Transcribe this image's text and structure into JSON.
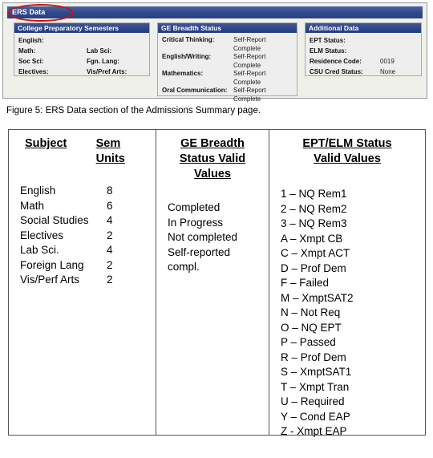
{
  "screenshot": {
    "window_title": "ERS Data",
    "annotation": "red-oval-around-ers-data",
    "accent_titlebar_color": "#2f4a8c",
    "annotation_color": "#cc1111",
    "panels": [
      {
        "id": "college_prep",
        "title": "College Preparatory Semesters",
        "fields": [
          {
            "label": "English:",
            "value": ""
          },
          {
            "label": "",
            "value": ""
          },
          {
            "label": "Math:",
            "value": ""
          },
          {
            "label": "Lab Sci:",
            "value": ""
          },
          {
            "label": "Soc Sci:",
            "value": ""
          },
          {
            "label": "Fgn. Lang:",
            "value": ""
          },
          {
            "label": "Electives:",
            "value": ""
          },
          {
            "label": "Vis/Pref Arts:",
            "value": ""
          }
        ]
      },
      {
        "id": "ge_breadth",
        "title": "GE Breadth Status",
        "fields": [
          {
            "label": "Critical Thinking:",
            "value": "Self-Report"
          },
          {
            "label": "",
            "value": "Complete"
          },
          {
            "label": "English/Writing:",
            "value": "Self-Report"
          },
          {
            "label": "",
            "value": "Complete"
          },
          {
            "label": "Mathematics:",
            "value": "Self-Report"
          },
          {
            "label": "",
            "value": "Complete"
          },
          {
            "label": "Oral Communication:",
            "value": "Self-Report"
          },
          {
            "label": "",
            "value": "Complete"
          }
        ]
      },
      {
        "id": "additional_data",
        "title": "Additional Data",
        "fields": [
          {
            "label": "EPT Status:",
            "value": ""
          },
          {
            "label": "ELM Status:",
            "value": ""
          },
          {
            "label": "Residence Code:",
            "value": "0019"
          },
          {
            "label": "CSU Cred Status:",
            "value": "None"
          }
        ]
      }
    ]
  },
  "caption": "Figure 5:  ERS Data section of the Admissions Summary page.",
  "table": {
    "subject_column": {
      "header_subject": "Subject",
      "header_units": "Sem Units",
      "rows": [
        {
          "subject": "English",
          "units": "8"
        },
        {
          "subject": "Math",
          "units": "6"
        },
        {
          "subject": "Social Studies",
          "units": "4"
        },
        {
          "subject": "Electives",
          "units": "2"
        },
        {
          "subject": "Lab Sci.",
          "units": "4"
        },
        {
          "subject": "Foreign Lang",
          "units": "2"
        },
        {
          "subject": "Vis/Perf Arts",
          "units": "2"
        }
      ]
    },
    "ge_column": {
      "header_line1": "GE Breadth",
      "header_line2": "Status Valid",
      "header_line3": "Values",
      "values": [
        "Completed",
        "In Progress",
        "Not completed",
        "Self-reported",
        "compl."
      ]
    },
    "ept_column": {
      "header_line1": "EPT/ELM Status",
      "header_line2": "Valid Values",
      "values": [
        "1 – NQ Rem1",
        "2 – NQ Rem2",
        "3 – NQ Rem3",
        "A – Xmpt CB",
        "C – Xmpt ACT",
        "D – Prof Dem",
        "F – Failed",
        "M – XmptSAT2",
        "N – Not Req",
        "O – NQ EPT",
        "P – Passed",
        "R – Prof Dem",
        "S – XmptSAT1",
        "T – Xmpt Tran",
        "U – Required",
        "Y – Cond EAP",
        "Z -  Xmpt EAP"
      ]
    }
  }
}
